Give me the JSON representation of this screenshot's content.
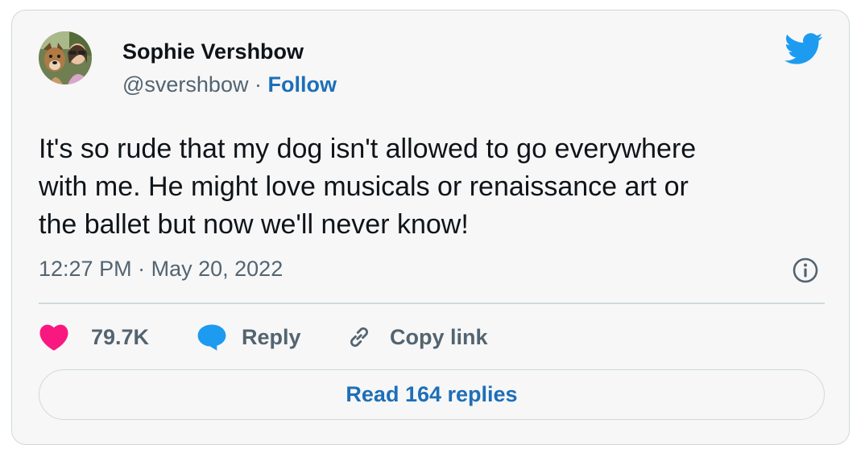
{
  "author": {
    "name": "Sophie Vershbow",
    "handle": "@svershbow",
    "separator": "·",
    "follow_label": "Follow"
  },
  "tweet": {
    "lines": [
      "It's so rude that my dog isn't allowed to go everywhere",
      "with me. He might love musicals or renaissance art or",
      "the ballet but now we'll never know!"
    ],
    "time": "12:27 PM",
    "separator": "·",
    "date": "May 20, 2022"
  },
  "actions": {
    "likes_count": "79.7K",
    "reply_label": "Reply",
    "copy_link_label": "Copy link"
  },
  "read_replies_label": "Read 164 replies",
  "icons": {
    "brand": "twitter-bird-icon",
    "like": "heart-icon",
    "reply": "speech-bubble-icon",
    "copy": "link-icon",
    "info": "info-icon"
  },
  "colors": {
    "brand_blue": "#1d9bf0",
    "link_blue": "#1d6fb8",
    "heart_pink": "#f91880",
    "text_primary": "#0f1419",
    "text_secondary": "#536471",
    "border": "#cfd9de",
    "card_bg": "#f7f7f7"
  }
}
